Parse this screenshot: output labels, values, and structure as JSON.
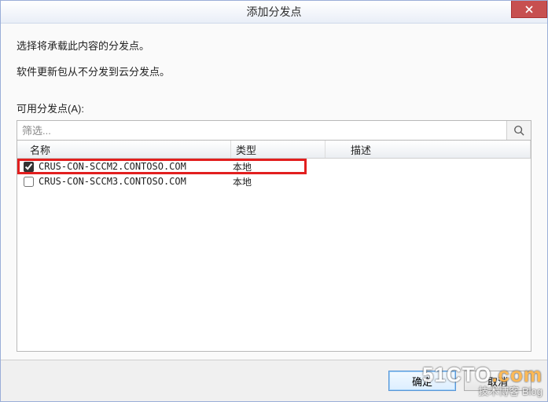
{
  "title": "添加分发点",
  "desc_line1": "选择将承载此内容的分发点。",
  "desc_line2": "软件更新包从不分发到云分发点。",
  "available_label": "可用分发点(A):",
  "filter_placeholder": "筛选...",
  "columns": {
    "name": "名称",
    "type": "类型",
    "desc": "描述"
  },
  "rows": [
    {
      "checked": true,
      "name": "CRUS-CON-SCCM2.CONTOSO.COM",
      "type": "本地",
      "desc": "",
      "highlight": true
    },
    {
      "checked": false,
      "name": "CRUS-CON-SCCM3.CONTOSO.COM",
      "type": "本地",
      "desc": ""
    }
  ],
  "buttons": {
    "ok": "确定",
    "cancel": "取消"
  },
  "watermark": {
    "line1a": "51CTO",
    "line1b": ".com",
    "line2": "技术博客   Blog"
  }
}
